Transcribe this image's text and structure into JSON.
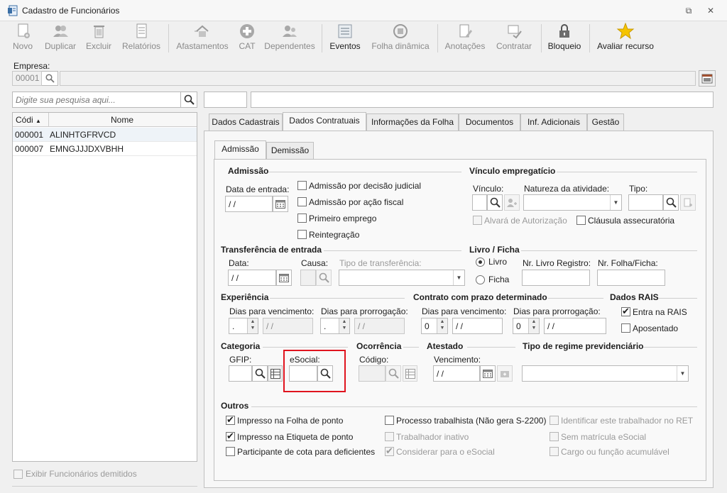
{
  "window": {
    "title": "Cadastro de Funcionários"
  },
  "toolbar": {
    "items": [
      {
        "label": "Novo",
        "icon": "new-file-icon"
      },
      {
        "label": "Duplicar",
        "icon": "users-icon"
      },
      {
        "label": "Excluir",
        "icon": "trash-icon"
      },
      {
        "label": "Relatórios",
        "icon": "report-icon"
      },
      {
        "label": "Afastamentos",
        "icon": "house-icon"
      },
      {
        "label": "CAT",
        "icon": "plus-cross-icon"
      },
      {
        "label": "Dependentes",
        "icon": "dependents-icon"
      },
      {
        "label": "Eventos",
        "icon": "events-list-icon"
      },
      {
        "label": "Folha dinâmica",
        "icon": "dynamic-sheet-icon"
      },
      {
        "label": "Anotações",
        "icon": "notes-icon"
      },
      {
        "label": "Contratar",
        "icon": "hire-icon"
      },
      {
        "label": "Bloqueio",
        "icon": "lock-icon"
      },
      {
        "label": "Avaliar recurso",
        "icon": "star-icon"
      }
    ]
  },
  "empresa": {
    "label": "Empresa:",
    "code_placeholder": "00001"
  },
  "search": {
    "placeholder": "Digite sua pesquisa aqui..."
  },
  "list": {
    "col_code": "Códi",
    "col_name": "Nome",
    "rows": [
      {
        "code": "000001",
        "name": "ALINHTGFRVCD"
      },
      {
        "code": "000007",
        "name": "EMNGJJJDXVBHH"
      }
    ],
    "show_dismissed": "Exibir Funcionários demitidos"
  },
  "tabs": [
    "Dados Cadastrais",
    "Dados Contratuais",
    "Informações da Folha",
    "Documentos",
    "Inf. Adicionais",
    "Gestão"
  ],
  "subtabs": [
    "Admissão",
    "Demissão"
  ],
  "admissao": {
    "title": "Admissão",
    "date_label": "Data de entrada:",
    "date_value": " /  /",
    "checks": [
      "Admissão por decisão judicial",
      "Admissão por ação fiscal",
      "Primeiro emprego",
      "Reintegração"
    ]
  },
  "vinculo": {
    "title": "Vínculo empregatício",
    "vinculo_label": "Vínculo:",
    "natureza_label": "Natureza da atividade:",
    "tipo_label": "Tipo:",
    "alvara": "Alvará de Autorização",
    "clausula": "Cláusula assecuratória"
  },
  "transferencia": {
    "title": "Transferência de entrada",
    "data_label": "Data:",
    "data_value": " /  /",
    "causa_label": "Causa:",
    "tipo_label": "Tipo de transferência:"
  },
  "livro": {
    "title": "Livro / Ficha",
    "opt_livro": "Livro",
    "opt_ficha": "Ficha",
    "nr_livro": "Nr. Livro Registro:",
    "nr_folha": "Nr. Folha/Ficha:"
  },
  "experiencia": {
    "title": "Experiência",
    "dias_venc": "Dias para vencimento:",
    "dias_prorr": "Dias para prorrogação:",
    "venc_value": ".",
    "venc_date": " /  /",
    "prorr_value": ".",
    "prorr_date": " /  /"
  },
  "contrato": {
    "title": "Contrato com prazo determinado",
    "dias_venc": "Dias para vencimento:",
    "dias_prorr": "Dias para prorrogação:",
    "venc_value": "0",
    "venc_date": " /  /",
    "prorr_value": "0",
    "prorr_date": " /  /"
  },
  "rais": {
    "title": "Dados RAIS",
    "entra": "Entra na RAIS",
    "aposentado": "Aposentado"
  },
  "categoria": {
    "title": "Categoria",
    "gfip": "GFIP:",
    "esocial": "eSocial:"
  },
  "ocorrencia": {
    "title": "Ocorrência",
    "codigo": "Código:"
  },
  "atestado": {
    "title": "Atestado",
    "vencimento": "Vencimento:",
    "date_value": " /  /"
  },
  "regime": {
    "title": "Tipo de regime previdenciário"
  },
  "outros": {
    "title": "Outros",
    "col1": [
      "Impresso na Folha de ponto",
      "Impresso na Etiqueta de ponto",
      "Participante de cota para deficientes"
    ],
    "col2": [
      "Processo trabalhista (Não gera S-2200)",
      "Trabalhador inativo",
      "Considerar para o eSocial"
    ],
    "col3": [
      "Identificar este trabalhador no RET",
      "Sem matrícula eSocial",
      "Cargo ou função acumulável"
    ]
  },
  "colors": {
    "highlight": "#e0141e",
    "star": "#f5c400"
  }
}
